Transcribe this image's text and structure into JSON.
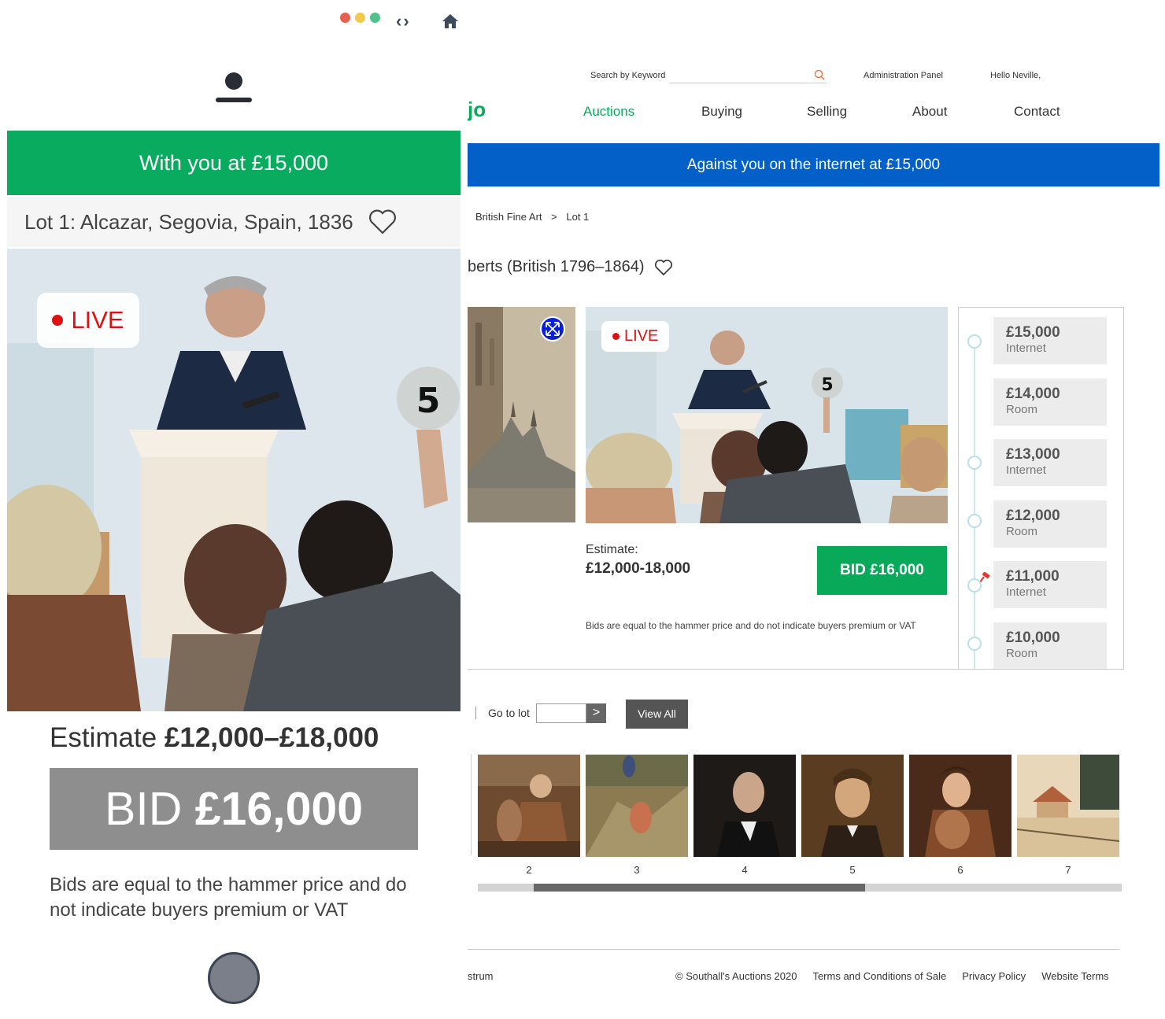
{
  "chrome": {
    "dot_colors": [
      "#e5604d",
      "#f1c94b",
      "#4fc289"
    ],
    "nav_arrows": "‹›"
  },
  "desktop": {
    "topbar": {
      "search_label": "Search by Keyword",
      "search_placeholder": "",
      "admin_link": "Administration Panel",
      "greeting": "Hello Neville,"
    },
    "logo_fragment": "jo",
    "nav": [
      {
        "label": "Auctions",
        "active": true
      },
      {
        "label": "Buying",
        "active": false
      },
      {
        "label": "Selling",
        "active": false
      },
      {
        "label": "About",
        "active": false
      },
      {
        "label": "Contact",
        "active": false
      }
    ],
    "status_bar": "Against you on the internet at £15,000",
    "breadcrumb": [
      "British Fine Art",
      ">",
      "Lot 1"
    ],
    "lot_title": "berts (British 1796–1864)",
    "live_badge": "LIVE",
    "paddle_number": "5",
    "estimate_label": "Estimate:",
    "estimate_value": "£12,000-18,000",
    "bid_button": "BID £16,000",
    "bid_note": "Bids are equal to the hammer price and do not indicate buyers premium or VAT",
    "bid_history": [
      {
        "amount": "£15,000",
        "source": "Internet"
      },
      {
        "amount": "£14,000",
        "source": "Room"
      },
      {
        "amount": "£13,000",
        "source": "Internet"
      },
      {
        "amount": "£12,000",
        "source": "Room"
      },
      {
        "amount": "£11,000",
        "source": "Internet"
      },
      {
        "amount": "£10,000",
        "source": "Room"
      }
    ],
    "goto_lot_label": "Go to lot",
    "goto_lot_value": "",
    "goto_arrow": ">",
    "view_all": "View All",
    "thumbnails": [
      {
        "number": "2"
      },
      {
        "number": "3"
      },
      {
        "number": "4"
      },
      {
        "number": "5"
      },
      {
        "number": "6"
      },
      {
        "number": "7"
      }
    ],
    "footer": {
      "left": "strum",
      "copyright": "© Southall's Auctions 2020",
      "links": [
        "Terms and Conditions of Sale",
        "Privacy Policy",
        "Website Terms"
      ]
    },
    "colors": {
      "accent_green": "#09a95a",
      "status_blue": "#0260c8"
    }
  },
  "mobile": {
    "status_bar": "With you at £15,000",
    "lot_title": "Lot 1: Alcazar, Segovia, Spain, 1836",
    "live_badge": "LIVE",
    "paddle_number": "5",
    "estimate_label": "Estimate",
    "estimate_value": "£12,000–£18,000",
    "bid_label": "BID",
    "bid_amount": "£16,000",
    "bid_note": "Bids are equal to the hammer price and do not indicate buyers premium or VAT",
    "colors": {
      "status_green": "#09ab5f",
      "bid_grey": "#8e8e8e"
    }
  }
}
